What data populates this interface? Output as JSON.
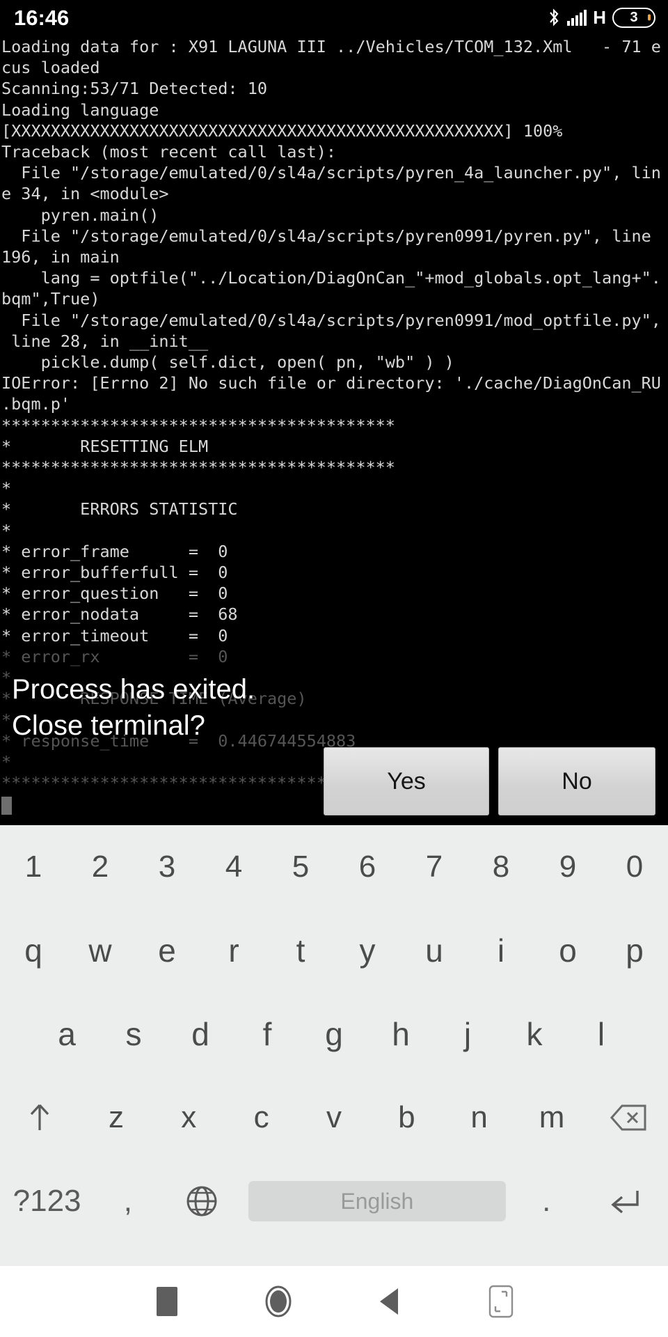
{
  "status_bar": {
    "clock": "16:46",
    "bluetooth_icon": "bluetooth-icon",
    "signal_icon": "signal-bars-icon",
    "network_type": "H",
    "battery_level": "3",
    "battery_icon": "battery-icon"
  },
  "terminal": {
    "lines": [
      {
        "text": "Loading data for : X91 LAGUNA III ../Vehicles/TCOM_132.Xml   - 71 e",
        "dim": false
      },
      {
        "text": "cus loaded",
        "dim": false
      },
      {
        "text": "Scanning:53/71 Detected: 10",
        "dim": false
      },
      {
        "text": "Loading language",
        "dim": false
      },
      {
        "text": "[XXXXXXXXXXXXXXXXXXXXXXXXXXXXXXXXXXXXXXXXXXXXXXXXXX] 100%",
        "dim": false
      },
      {
        "text": "Traceback (most recent call last):",
        "dim": false
      },
      {
        "text": "  File \"/storage/emulated/0/sl4a/scripts/pyren_4a_launcher.py\", lin",
        "dim": false
      },
      {
        "text": "e 34, in <module>",
        "dim": false
      },
      {
        "text": "    pyren.main()",
        "dim": false
      },
      {
        "text": "  File \"/storage/emulated/0/sl4a/scripts/pyren0991/pyren.py\", line",
        "dim": false
      },
      {
        "text": "196, in main",
        "dim": false
      },
      {
        "text": "    lang = optfile(\"../Location/DiagOnCan_\"+mod_globals.opt_lang+\".",
        "dim": false
      },
      {
        "text": "bqm\",True)",
        "dim": false
      },
      {
        "text": "  File \"/storage/emulated/0/sl4a/scripts/pyren0991/mod_optfile.py\",",
        "dim": false
      },
      {
        "text": " line 28, in __init__",
        "dim": false
      },
      {
        "text": "    pickle.dump( self.dict, open( pn, \"wb\" ) )",
        "dim": false
      },
      {
        "text": "IOError: [Errno 2] No such file or directory: './cache/DiagOnCan_RU",
        "dim": false
      },
      {
        "text": ".bqm.p'",
        "dim": false
      },
      {
        "text": "****************************************",
        "dim": false
      },
      {
        "text": "*       RESETTING ELM",
        "dim": false
      },
      {
        "text": "****************************************",
        "dim": false
      },
      {
        "text": "*",
        "dim": false
      },
      {
        "text": "*       ERRORS STATISTIC",
        "dim": false
      },
      {
        "text": "*",
        "dim": false
      },
      {
        "text": "* error_frame      =  0",
        "dim": false
      },
      {
        "text": "* error_bufferfull =  0",
        "dim": false
      },
      {
        "text": "* error_question   =  0",
        "dim": false
      },
      {
        "text": "* error_nodata     =  68",
        "dim": false
      },
      {
        "text": "* error_timeout    =  0",
        "dim": false
      },
      {
        "text": "* error_rx         =  0",
        "dim": true
      },
      {
        "text": "*",
        "dim": true
      },
      {
        "text": "*       RESPONSE TIME (Average)",
        "dim": true
      },
      {
        "text": "*",
        "dim": true
      },
      {
        "text": "* response_time    =  0.446744554883",
        "dim": true
      },
      {
        "text": "*",
        "dim": true
      },
      {
        "text": "****************************************",
        "dim": true
      }
    ]
  },
  "dialog": {
    "message_line1": "Process has exited.",
    "message_line2": "Close terminal?",
    "yes_label": "Yes",
    "no_label": "No"
  },
  "keyboard": {
    "number_row": [
      "1",
      "2",
      "3",
      "4",
      "5",
      "6",
      "7",
      "8",
      "9",
      "0"
    ],
    "top_row": [
      "q",
      "w",
      "e",
      "r",
      "t",
      "y",
      "u",
      "i",
      "o",
      "p"
    ],
    "home_row": [
      "a",
      "s",
      "d",
      "f",
      "g",
      "h",
      "j",
      "k",
      "l"
    ],
    "bottom_row": [
      "z",
      "x",
      "c",
      "v",
      "b",
      "n",
      "m"
    ],
    "shift_icon": "shift-arrow-up-icon",
    "backspace_icon": "backspace-icon",
    "symbols_label": "?123",
    "comma_label": ",",
    "globe_icon": "globe-language-icon",
    "spacebar_label": "English",
    "period_label": ".",
    "enter_icon": "enter-return-icon"
  },
  "nav_bar": {
    "recents_icon": "recents-square-icon",
    "home_icon": "home-circle-icon",
    "back_icon": "back-triangle-icon",
    "resize_icon": "resize-window-icon"
  },
  "colors": {
    "terminal_bg": "#000000",
    "terminal_fg": "#d8d8d8",
    "terminal_dim": "#555555",
    "keyboard_bg": "#eceded",
    "key_fg": "#4b4b4b",
    "button_face": "#d8d8d8",
    "battery_tip": "#e8a33d",
    "nav_bg": "#ffffff"
  }
}
